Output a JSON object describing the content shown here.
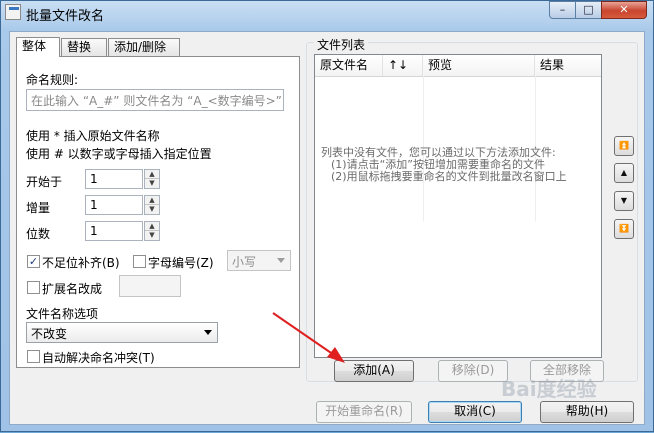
{
  "window": {
    "title": "批量文件改名",
    "min_glyph": "–",
    "max_glyph": "□",
    "close_glyph": "✕"
  },
  "tabs": [
    "整体",
    "替换",
    "添加/删除"
  ],
  "left": {
    "rule_label": "命名规则:",
    "rule_placeholder": "在此输入 “A_#” 则文件名为 “A_<数字编号>”",
    "hint1": "使用 * 插入原始文件名称",
    "hint2": "使用 # 以数字或字母插入指定位置",
    "start_label": "开始于",
    "start_value": "1",
    "step_label": "增量",
    "step_value": "1",
    "digits_label": "位数",
    "digits_value": "1",
    "pad_label": "不足位补齐(B)",
    "pad_checked": "✓",
    "letter_label": "字母编号(Z)",
    "case_value": "小写",
    "ext_label": "扩展名改成",
    "ext_value": "",
    "name_opt_label": "文件名称选项",
    "name_opt_value": "不改变",
    "auto_conflict_label": "自动解决命名冲突(T)"
  },
  "filelist": {
    "group_title": "文件列表",
    "columns": [
      "原文件名",
      "↑↓",
      "预览",
      "结果"
    ],
    "empty_line1": "列表中没有文件，您可以通过以下方法添加文件:",
    "empty_line2": "(1)请点击“添加”按钮增加需要重命名的文件",
    "empty_line3": "(2)用鼠标拖拽要重命名的文件到批量改名窗口上",
    "add_button": "添加(A)",
    "remove_button": "移除(D)",
    "remove_all_button": "全部移除"
  },
  "nav": {
    "top_icon": "⏫",
    "up_icon": "▲",
    "down_icon": "▼",
    "bottom_icon": "⏬"
  },
  "footer": {
    "start_button": "开始重命名(R)",
    "cancel_button": "取消(C)",
    "help_button": "帮助(H)"
  },
  "watermark": "Bai度经验",
  "colors": {
    "titlebar": "#a9c9ea",
    "client_bg": "#f0f0f0",
    "annotation_arrow": "#e02020"
  }
}
